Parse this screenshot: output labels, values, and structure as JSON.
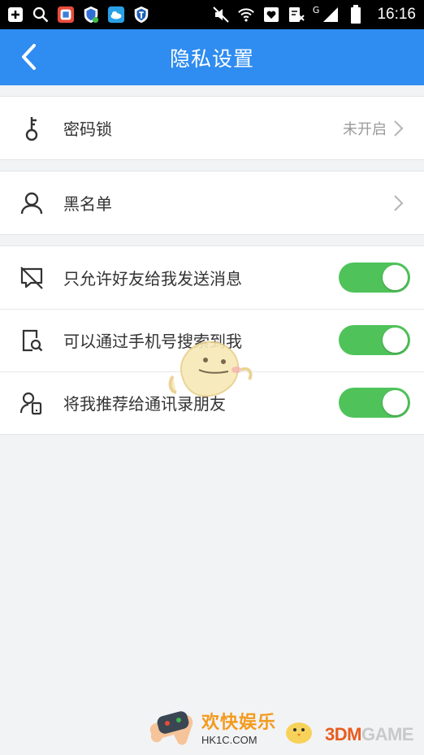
{
  "status_bar": {
    "time": "16:16",
    "network_label": "G",
    "left_icons": [
      "add-box-icon",
      "search-icon",
      "app-store-icon",
      "shield-app-icon",
      "cloud-app-icon",
      "security-app-icon"
    ],
    "right_icons": [
      "mute-icon",
      "wifi-icon",
      "heart-icon",
      "nfc-icon",
      "signal-icon",
      "battery-icon"
    ]
  },
  "navbar": {
    "title": "隐私设置",
    "back_icon": "chevron-left-icon"
  },
  "groups": [
    {
      "rows": [
        {
          "icon": "key-icon",
          "label": "密码锁",
          "value": "未开启",
          "accessory": "chevron"
        }
      ]
    },
    {
      "rows": [
        {
          "icon": "person-icon",
          "label": "黑名单",
          "accessory": "chevron"
        }
      ]
    },
    {
      "rows": [
        {
          "icon": "message-blocked-icon",
          "label": "只允许好友给我发送消息",
          "toggle": true
        },
        {
          "icon": "phone-search-icon",
          "label": "可以通过手机号搜索到我",
          "toggle": true
        },
        {
          "icon": "contact-recommend-icon",
          "label": "将我推荐给通讯录朋友",
          "toggle": true
        }
      ]
    }
  ],
  "colors": {
    "navbar_bg": "#2f8cf0",
    "toggle_on": "#4fc35a",
    "page_bg": "#f2f3f5"
  },
  "watermarks": {
    "site_name": "欢快娱乐",
    "site_url": "HK1C.COM",
    "brand_prefix": "3DM",
    "brand_suffix": "GAME"
  }
}
